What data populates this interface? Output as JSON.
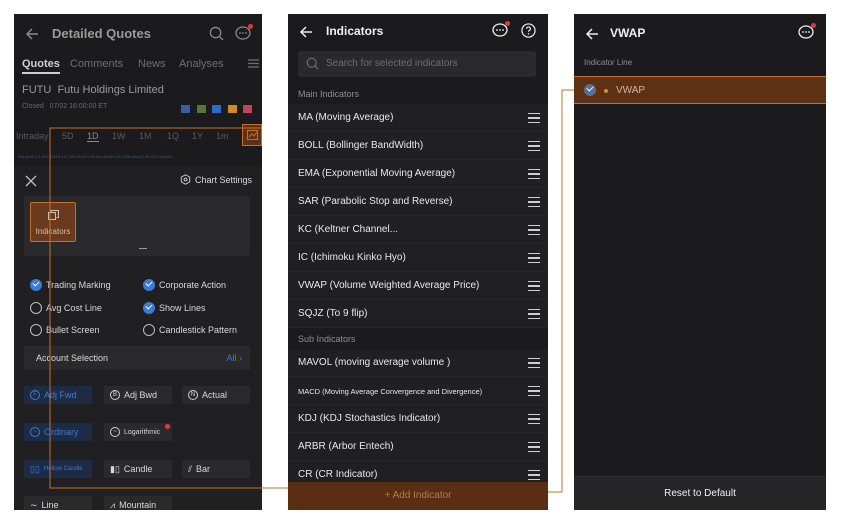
{
  "colors": {
    "accent_blue": "#3a7bd5",
    "highlight_orange": "#c5702a",
    "highlight_bg": "#5e3014",
    "panel_bg": "#1b1b1d",
    "red_badge": "#e53935"
  },
  "panel1": {
    "title": "Detailed Quotes",
    "tabs": [
      "Quotes",
      "Comments",
      "News",
      "Analyses"
    ],
    "stock_code": "FUTU",
    "stock_name": "Futu Holdings Limited",
    "status": "Closed",
    "time": "07/02 16:00:00 ET",
    "ranges": [
      "Intraday",
      "5D",
      "1D",
      "1W",
      "1M",
      "1Q",
      "1Y",
      "1m"
    ],
    "ma_strip": "MA MA5:171.696 MA10:167.582 MA20:156.864 MA30:151.936 MA60:146.321 MA120:...",
    "chart_settings": "Chart Settings",
    "indicators_label": "Indicators",
    "options": {
      "trading_marking": "Trading Marking",
      "corporate_action": "Corporate Action",
      "avg_cost_line": "Avg Cost Line",
      "show_lines": "Show Lines",
      "bullet_screen": "Bullet Screen",
      "candlestick_pattern": "Candlestick Pattern"
    },
    "account_selection": "Account Selection",
    "account_value": "All",
    "adj": [
      "Adj Fwd",
      "Adj Bwd",
      "Actual"
    ],
    "scale": [
      "Ordinary",
      "Logarithmic"
    ],
    "chart_types": [
      "Hollow Candle",
      "Candle",
      "Bar",
      "Line",
      "Mountain"
    ]
  },
  "panel2": {
    "title": "Indicators",
    "search_placeholder": "Search for selected indicators",
    "main_section": "Main Indicators",
    "main_indicators": [
      "MA (Moving Average)",
      "BOLL (Bollinger BandWidth)",
      "EMA (Exponential Moving Average)",
      "SAR (Parabolic Stop and Reverse)",
      "KC (Keltner Channel...",
      "IC (Ichimoku Kinko Hyo)",
      "VWAP (Volume Weighted Average Price)",
      "SQJZ (To 9 flip)"
    ],
    "sub_section": "Sub Indicators",
    "sub_indicators": [
      "MAVOL (moving average volume )",
      "MACD (Moving Average Convergence and Divergence)",
      "KDJ (KDJ Stochastics Indicator)",
      "ARBR (Arbor Entech)",
      "CR (CR Indicator)"
    ],
    "add_indicator": "+   Add Indicator"
  },
  "panel3": {
    "title": "VWAP",
    "indicator_line_label": "Indicator Line",
    "line_name": "VWAP",
    "reset": "Reset to Default"
  }
}
